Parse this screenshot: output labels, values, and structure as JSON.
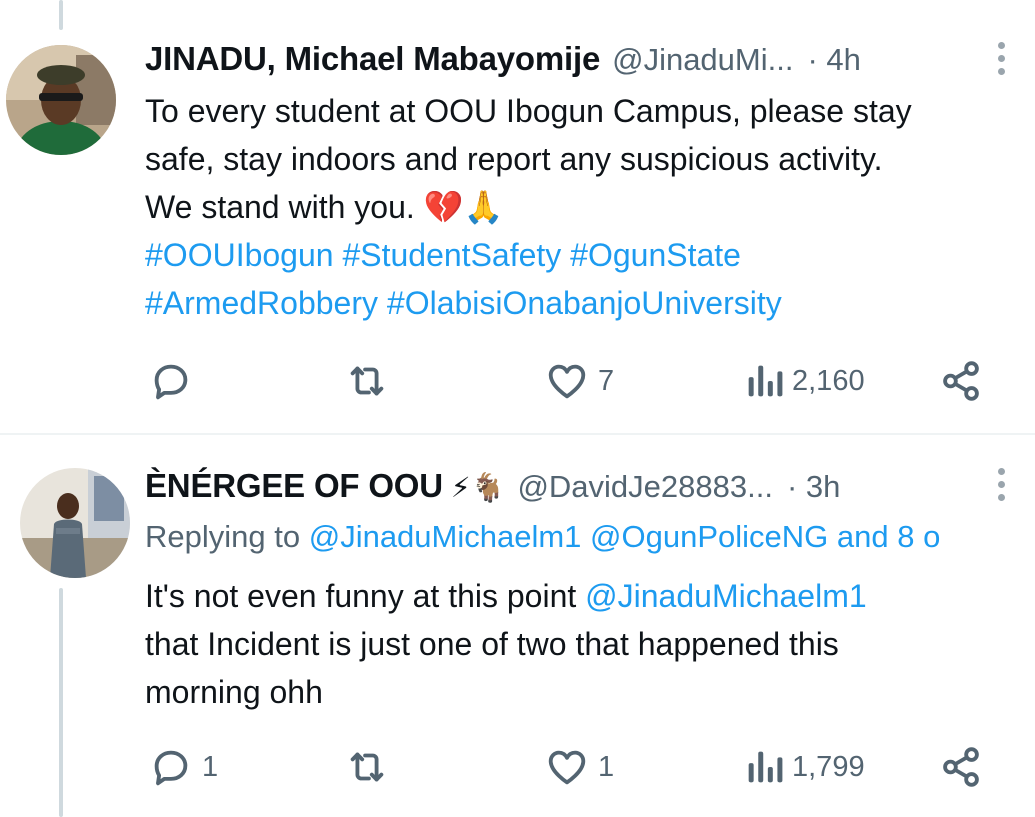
{
  "tweets": [
    {
      "display_name": "JINADU, Michael Mabayomije",
      "handle": "@JinaduMi...",
      "time": "· 4h",
      "lines": [
        "To every student at OOU Ibogun Campus, please stay",
        "safe, stay indoors and report any suspicious activity.",
        "We stand with you. 💔🙏"
      ],
      "hashtag_lines": [
        "#OOUIbogun #StudentSafety #OgunState",
        "#ArmedRobbery #OlabisiOnabanjoUniversity"
      ],
      "replies": "",
      "retweets": "",
      "likes": "7",
      "views": "2,160"
    },
    {
      "display_name": "ÈNÉRGEE OF OOU",
      "name_emoji": "⚡🐐",
      "handle": "@DavidJe28883...",
      "time": "· 3h",
      "replying_prefix": "Replying to",
      "replying_targets": "@JinaduMichaelm1 @OgunPoliceNG and 8 o",
      "line1_text": "It's not even funny at this point",
      "line1_mention": "@JinaduMichaelm1",
      "lines": [
        "that Incident is just one of two that happened this",
        "morning ohh"
      ],
      "replies": "1",
      "retweets": "",
      "likes": "1",
      "views": "1,799"
    }
  ],
  "icons": {
    "reply": "speech-bubble-icon",
    "retweet": "retweet-arrows-icon",
    "like": "heart-outline-icon",
    "views": "bar-chart-icon",
    "share": "share-nodes-icon",
    "more": "vertical-ellipsis-icon"
  },
  "colors": {
    "link": "#1d9bf0",
    "secondary_text": "#536471",
    "primary_text": "#0f1419",
    "thread_line": "#cfd9de"
  }
}
